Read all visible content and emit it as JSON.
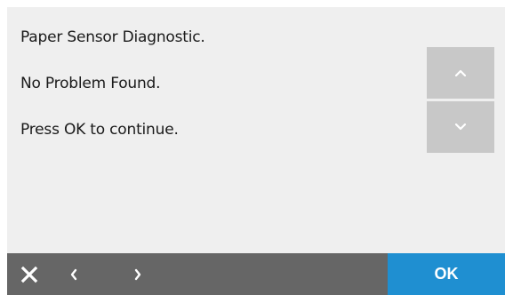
{
  "message": {
    "line1": "Paper Sensor Diagnostic.",
    "line2": "No Problem Found.",
    "line3": "Press OK to continue."
  },
  "scroll": {
    "up_icon": "chevron-up-icon",
    "down_icon": "chevron-down-icon"
  },
  "toolbar": {
    "close_icon": "close-icon",
    "back_icon": "chevron-left-icon",
    "forward_icon": "chevron-right-icon",
    "ok_label": "OK"
  },
  "colors": {
    "background": "#efefef",
    "toolbar": "#666666",
    "accent": "#1f8fd1",
    "scroll_button": "#c8c8c8"
  }
}
